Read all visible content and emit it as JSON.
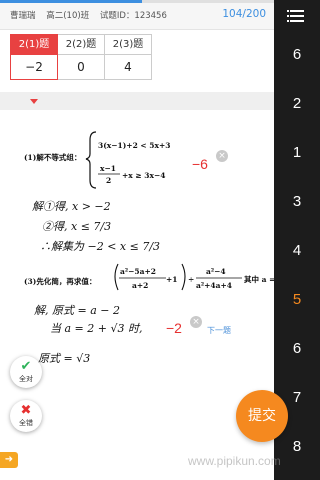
{
  "header": {
    "student_name": "曹瑞瑞",
    "class_name": "高二(10)班",
    "question_id": "试题ID：123456",
    "page_counter": "104/200",
    "progress": 0.52
  },
  "tabs": [
    {
      "label": "2(1)题",
      "score": "−2",
      "active": true
    },
    {
      "label": "2(2)题",
      "score": "0",
      "active": false
    },
    {
      "label": "2(3)题",
      "score": "4",
      "active": false
    }
  ],
  "problem1": {
    "label": "(1)解不等式组：",
    "ineq1": "3(x−1)+2 < 5x+3",
    "ineq2_num": "x−1",
    "ineq2_den": "2",
    "ineq2_rest": "+x ≥ 3x−4",
    "score_mark": "−6",
    "hand_lines": [
      "解①得, x > −2",
      "②得, x ≤ 7/3",
      "∴解集为 −2 < x ≤ 7/3"
    ]
  },
  "problem3": {
    "label": "(3)先化简，再求值：",
    "frac1_num": "a²−5a+2",
    "frac1_den": "a+2",
    "plus_one": "+1",
    "frac2_num": "a²−4",
    "frac2_den": "a²+4a+4",
    "tail": "其中 a =",
    "score_mark": "−2",
    "next_link": "下一题",
    "hand_lines": [
      "解, 原式 = a − 2",
      "当 a = 2 + √3 时,",
      "原式 = √3"
    ]
  },
  "buttons": {
    "all_correct": "全对",
    "all_wrong": "全错",
    "submit": "提交",
    "side_tab_icon": "arrow-right-icon"
  },
  "sidebar": {
    "questions": [
      "6",
      "2",
      "1",
      "3",
      "4",
      "5",
      "6",
      "7",
      "8"
    ],
    "current_index": 5
  },
  "watermark": "www.pipikun.com",
  "colors": {
    "accent_red": "#e84141",
    "accent_orange": "#f5891f",
    "link_blue": "#4a8fd8",
    "sidebar_bg": "#1c1c1c"
  }
}
